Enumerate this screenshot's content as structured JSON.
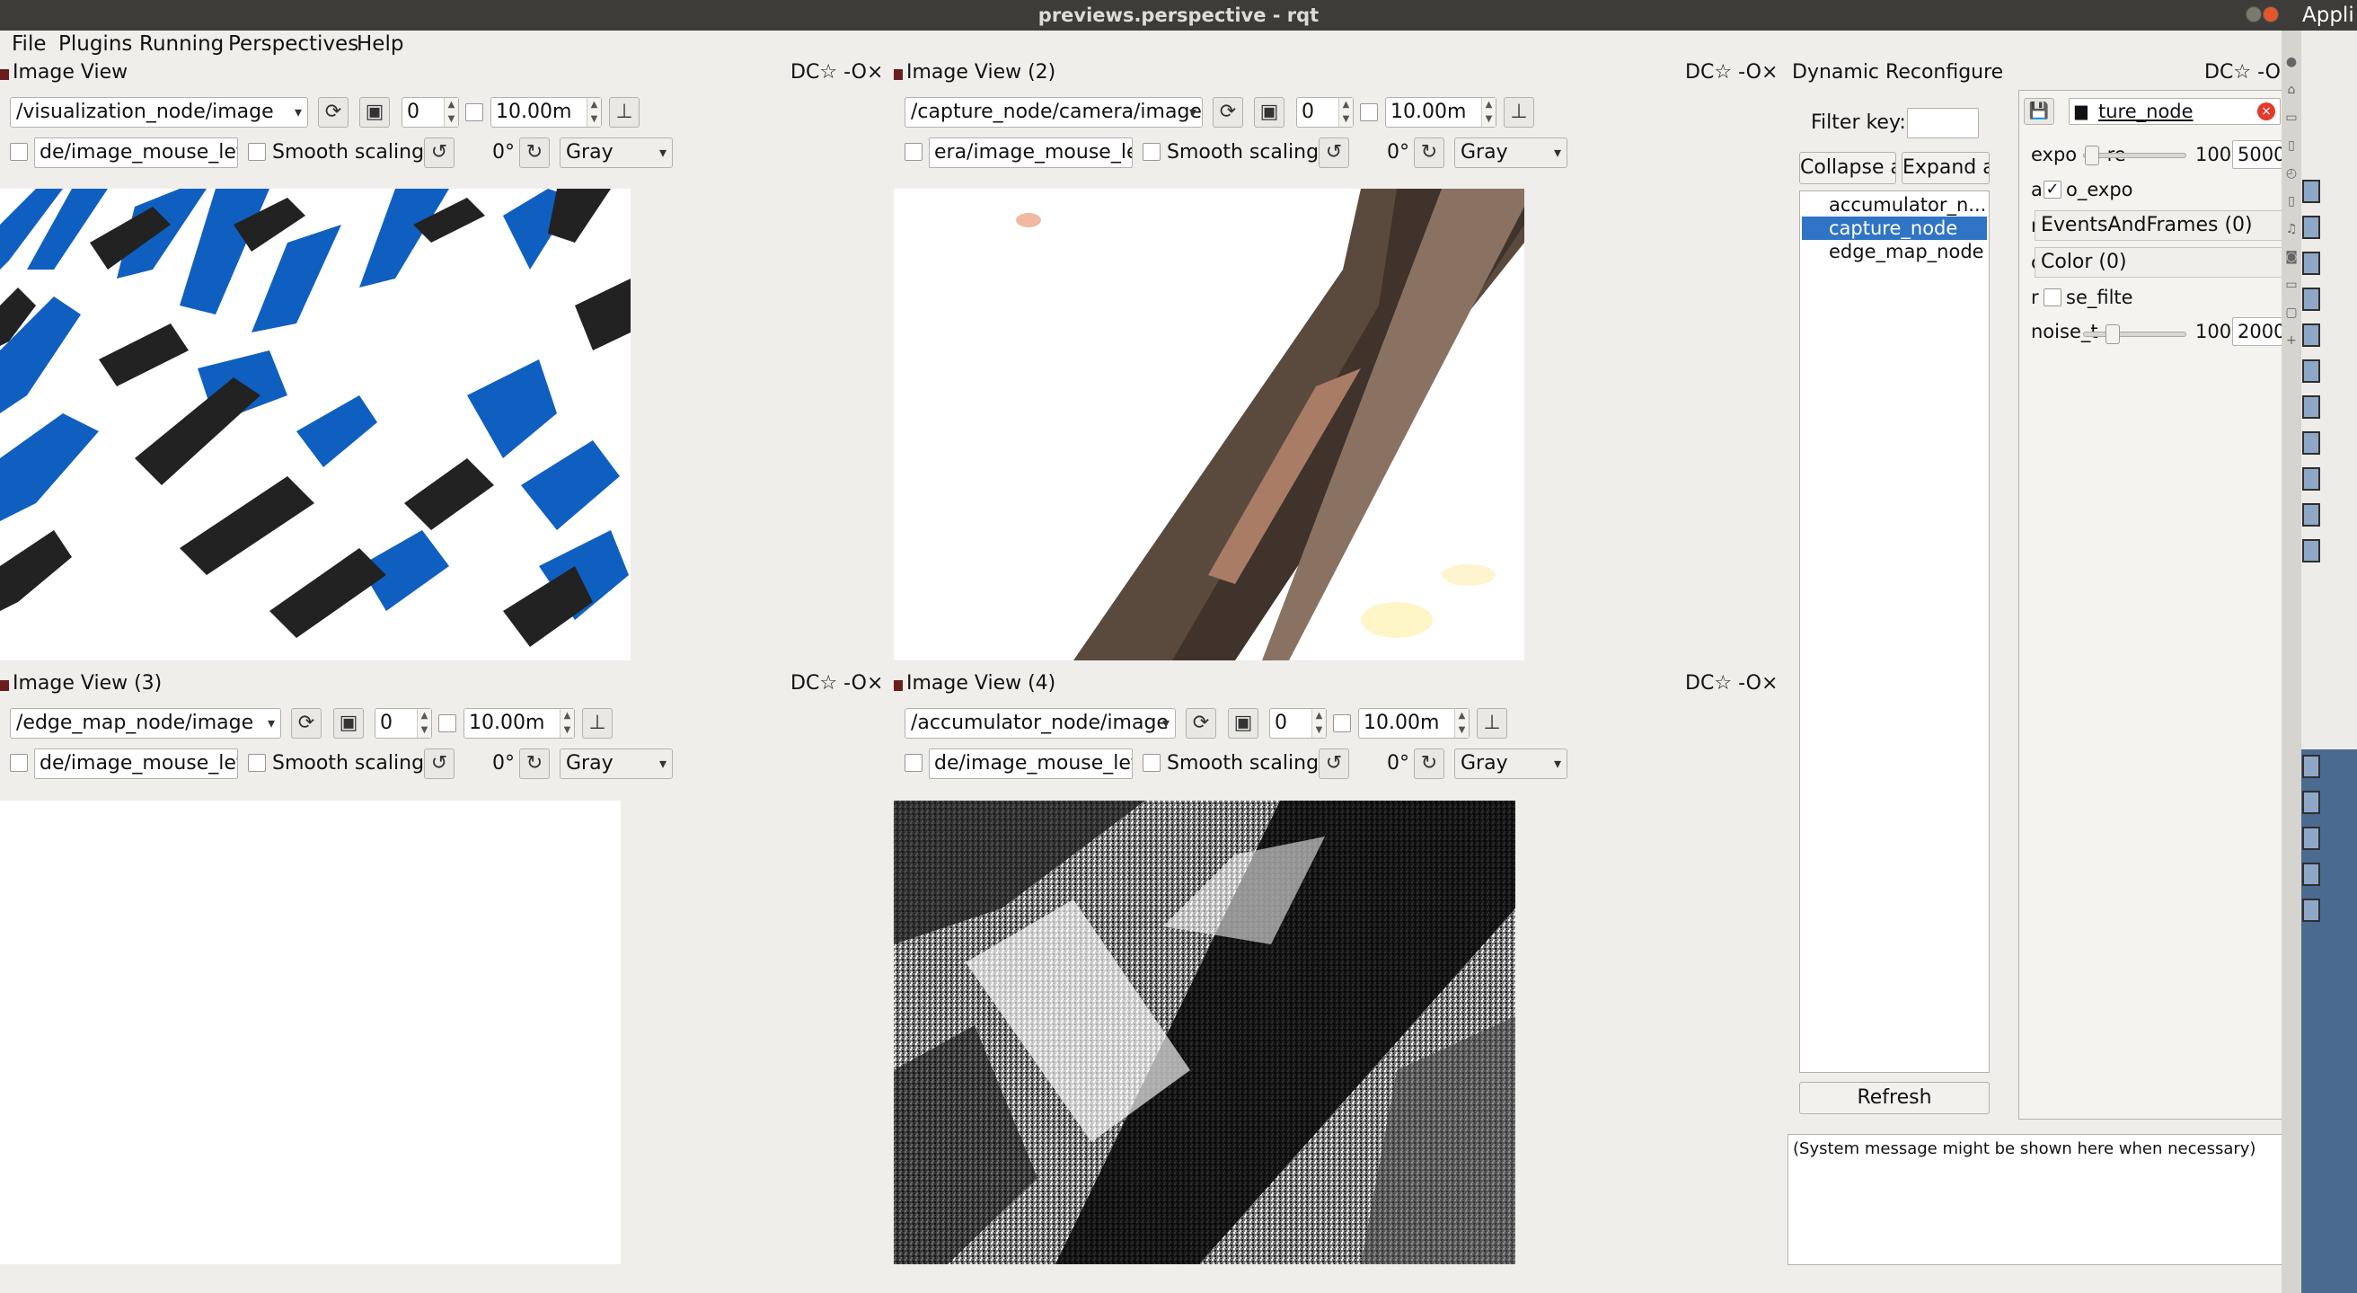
{
  "window": {
    "title": "previews.perspective - rqt",
    "right_label": "Appli"
  },
  "menu": {
    "items": [
      "File",
      "Plugins",
      "Running",
      "Perspectives",
      "Help"
    ]
  },
  "dock_controls": {
    "d": "D",
    "reload": "C",
    "gear": "☆",
    "minimize": "-",
    "float": "O",
    "close": "×"
  },
  "views": [
    {
      "title": "Image View",
      "topic": "/visualization_node/image",
      "num": "0",
      "timeout": "10.00m",
      "mouse_topic": "de/image_mouse_left",
      "smooth": "Smooth scaling",
      "rotation": "0°",
      "colormap": "Gray"
    },
    {
      "title": "Image View (2)",
      "topic": "/capture_node/camera/image",
      "num": "0",
      "timeout": "10.00m",
      "mouse_topic": "era/image_mouse_left",
      "smooth": "Smooth scaling",
      "rotation": "0°",
      "colormap": "Gray"
    },
    {
      "title": "Image View (3)",
      "topic": "/edge_map_node/image",
      "num": "0",
      "timeout": "10.00m",
      "mouse_topic": "de/image_mouse_left",
      "smooth": "Smooth scaling",
      "rotation": "0°",
      "colormap": "Gray"
    },
    {
      "title": "Image View (4)",
      "topic": "/accumulator_node/image",
      "num": "0",
      "timeout": "10.00m",
      "mouse_topic": "de/image_mouse_left",
      "smooth": "Smooth scaling",
      "rotation": "0°",
      "colormap": "Gray"
    }
  ],
  "dynrec": {
    "title": "Dynamic Reconfigure",
    "filter_label": "Filter key:",
    "filter_value": "",
    "collapse": "Collapse al",
    "expand": "Expand al",
    "nodes": [
      "accumulator_n...",
      "capture_node",
      "edge_map_node"
    ],
    "selected": "capture_node",
    "refresh": "Refresh",
    "node_name": "ture_node",
    "params": {
      "exposure_label": "expo",
      "exposure_label_tail": "re",
      "exposure_max": "100",
      "exposure_value": "5000",
      "exposure_level": 0.01,
      "auto_label": "a",
      "auto_tail": "o_expo",
      "auto_checked": true,
      "events_prefix": "r",
      "events_value": "EventsAndFrames (0)",
      "color_prefix": "c",
      "color_value": "Color (0)",
      "noise_prefix": "r",
      "noise_label": "se_filte",
      "noise_t_label": "noi",
      "noise_t_tail": "se_t",
      "noise_max": "100",
      "noise_value": "2000",
      "noise_level": 0.25
    },
    "system_message": "(System message might be shown here when necessary)"
  }
}
